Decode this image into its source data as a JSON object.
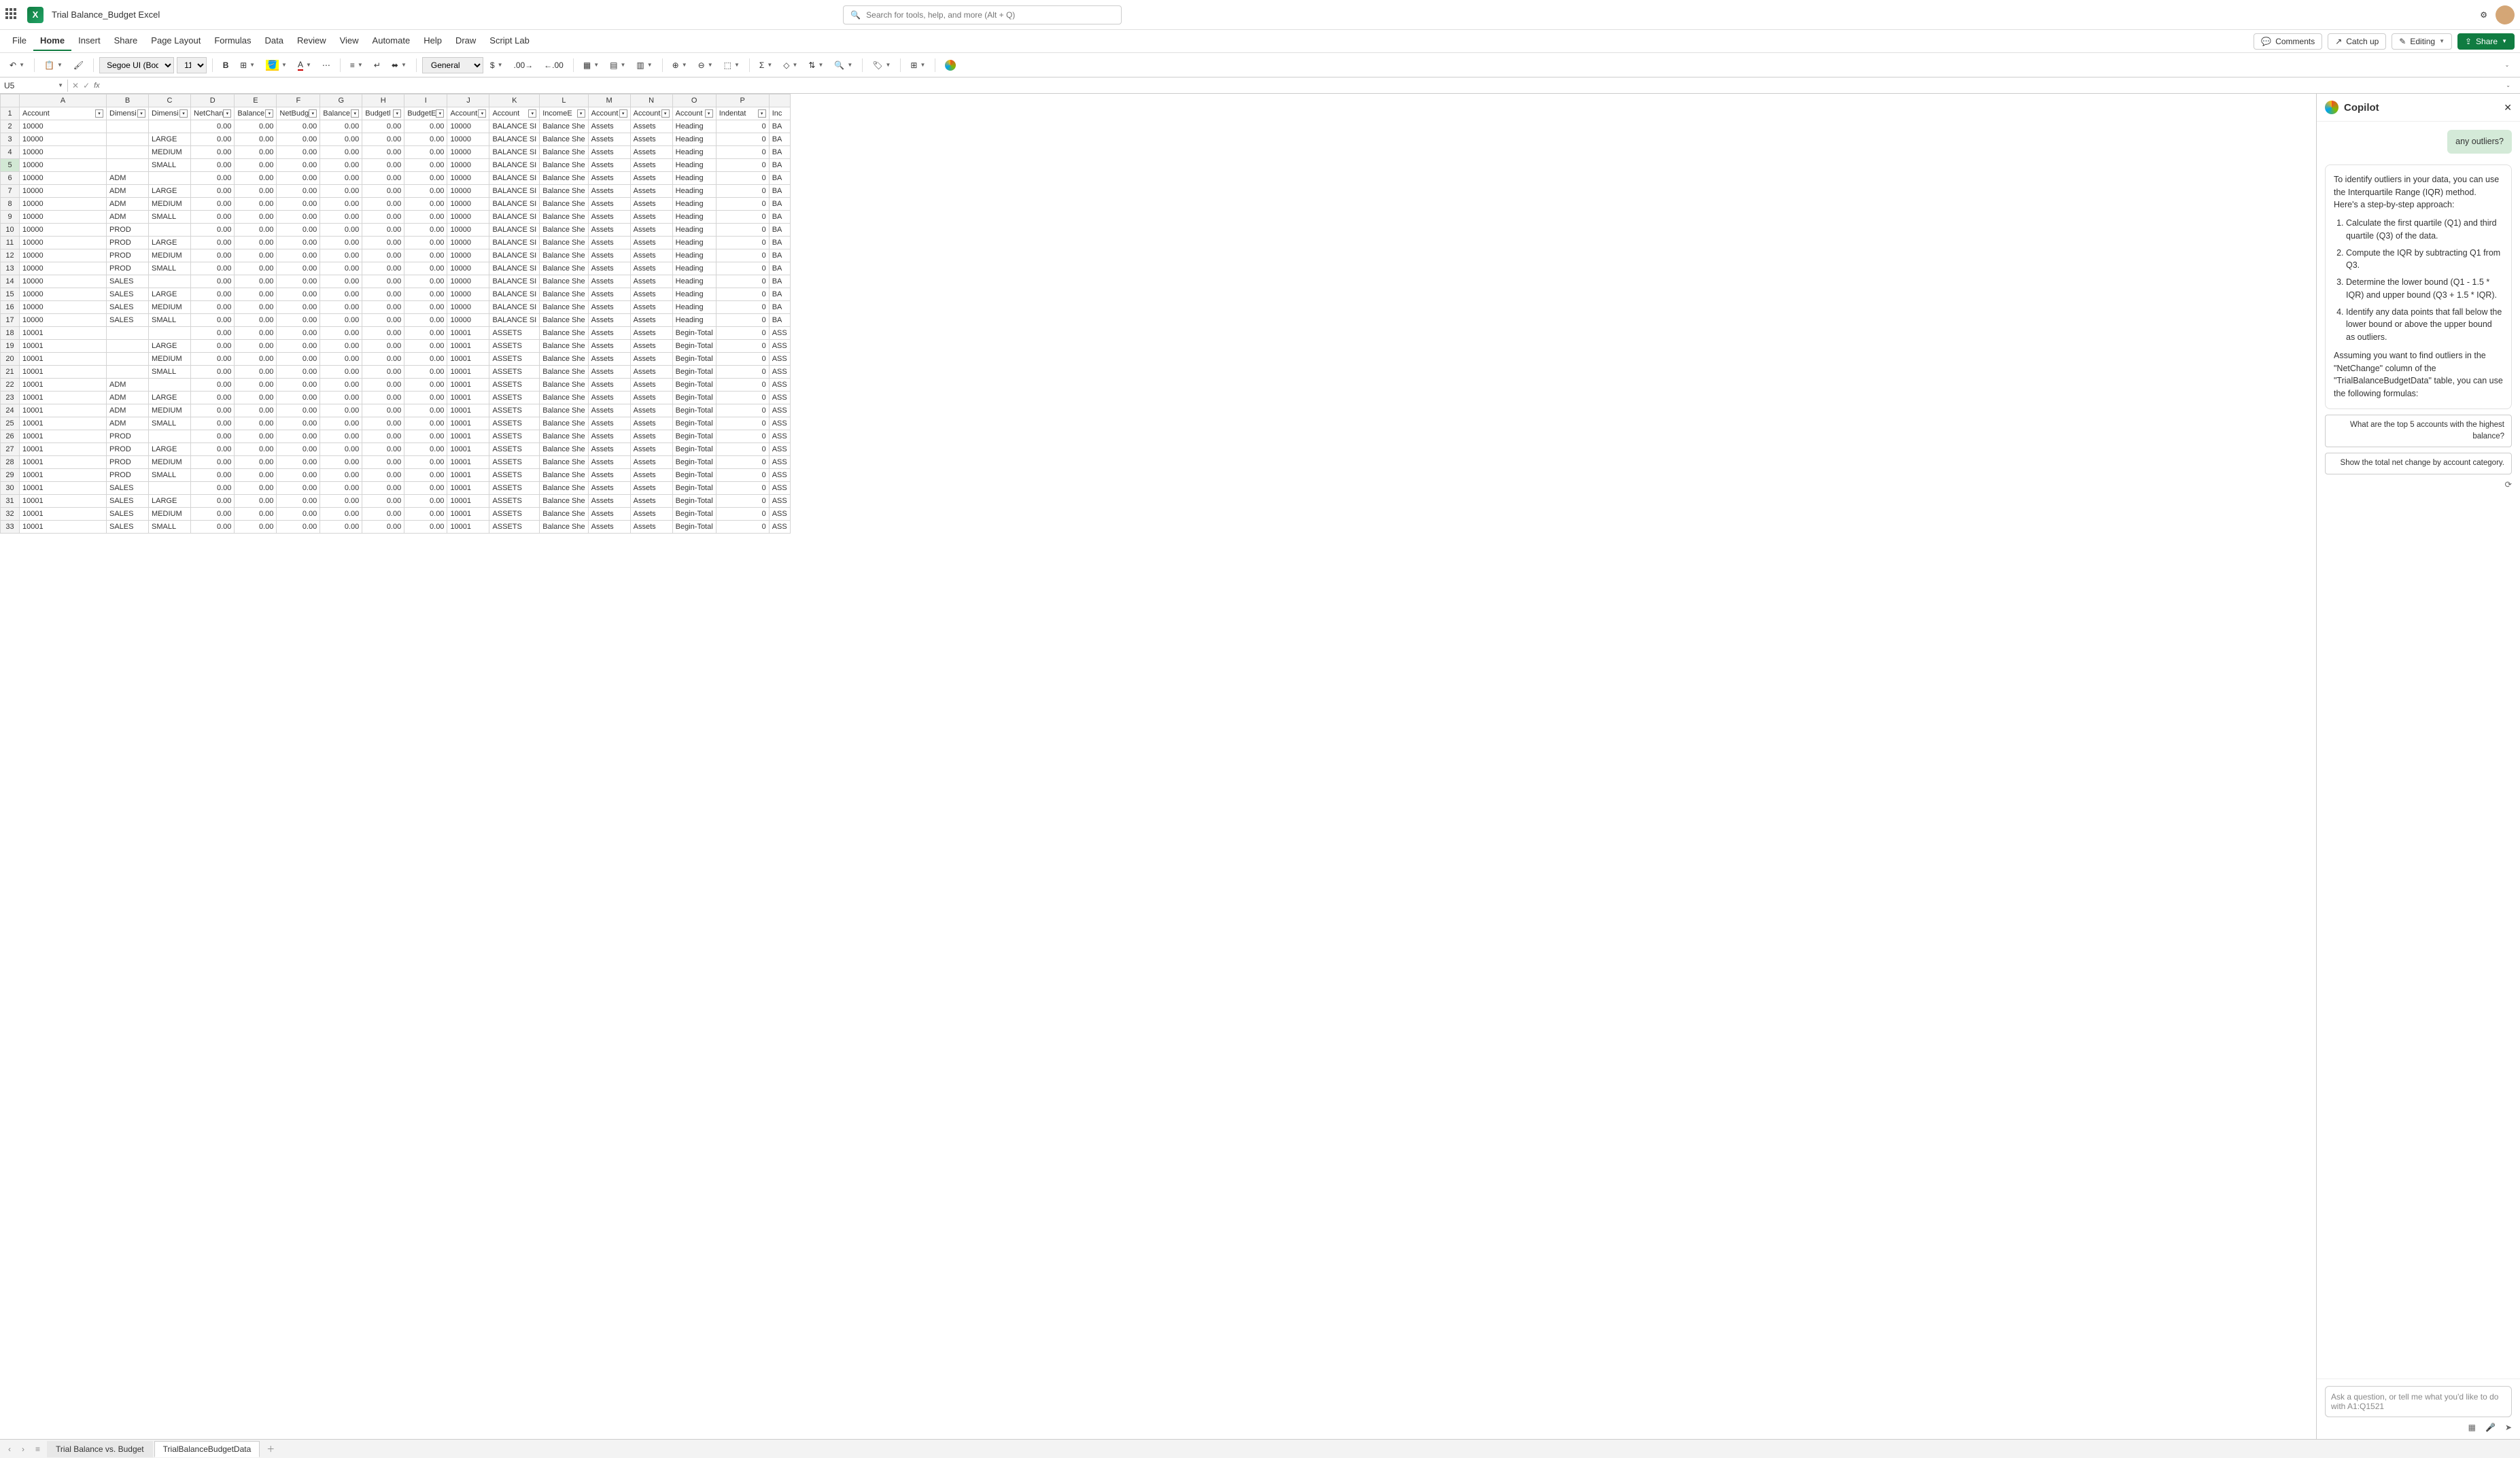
{
  "titlebar": {
    "doc_title": "Trial Balance_Budget Excel",
    "search_placeholder": "Search for tools, help, and more (Alt + Q)"
  },
  "menu": {
    "items": [
      "File",
      "Home",
      "Insert",
      "Share",
      "Page Layout",
      "Formulas",
      "Data",
      "Review",
      "View",
      "Automate",
      "Help",
      "Draw",
      "Script Lab"
    ],
    "active": "Home",
    "right": {
      "comments": "Comments",
      "catchup": "Catch up",
      "editing": "Editing",
      "share": "Share"
    }
  },
  "toolbar": {
    "font_name": "Segoe UI (Body)",
    "font_size": "11",
    "number_format": "General"
  },
  "formula": {
    "name_box": "U5"
  },
  "columns_letters": [
    "A",
    "B",
    "C",
    "D",
    "E",
    "F",
    "G",
    "H",
    "I",
    "J",
    "K",
    "L",
    "M",
    "N",
    "O",
    "P"
  ],
  "headers": [
    "Account",
    "Dimensi",
    "Dimensi",
    "NetChan",
    "Balance",
    "NetBudg",
    "Balance",
    "Budgetl",
    "BudgetE",
    "Account",
    "Account",
    "IncomeE",
    "Account",
    "Account",
    "Account",
    "Indentat"
  ],
  "partial_header_q": "Inc",
  "rows": [
    {
      "r": 2,
      "acct": "10000",
      "dim1": "",
      "dim2": "",
      "j": "10000",
      "k": "BALANCE SI",
      "l": "Balance She",
      "m": "Assets",
      "n": "Assets",
      "o": "Heading",
      "p": "0",
      "q": "BA"
    },
    {
      "r": 3,
      "acct": "10000",
      "dim1": "",
      "dim2": "LARGE",
      "j": "10000",
      "k": "BALANCE SI",
      "l": "Balance She",
      "m": "Assets",
      "n": "Assets",
      "o": "Heading",
      "p": "0",
      "q": "BA"
    },
    {
      "r": 4,
      "acct": "10000",
      "dim1": "",
      "dim2": "MEDIUM",
      "j": "10000",
      "k": "BALANCE SI",
      "l": "Balance She",
      "m": "Assets",
      "n": "Assets",
      "o": "Heading",
      "p": "0",
      "q": "BA"
    },
    {
      "r": 5,
      "acct": "10000",
      "dim1": "",
      "dim2": "SMALL",
      "j": "10000",
      "k": "BALANCE SI",
      "l": "Balance She",
      "m": "Assets",
      "n": "Assets",
      "o": "Heading",
      "p": "0",
      "q": "BA"
    },
    {
      "r": 6,
      "acct": "10000",
      "dim1": "ADM",
      "dim2": "",
      "j": "10000",
      "k": "BALANCE SI",
      "l": "Balance She",
      "m": "Assets",
      "n": "Assets",
      "o": "Heading",
      "p": "0",
      "q": "BA"
    },
    {
      "r": 7,
      "acct": "10000",
      "dim1": "ADM",
      "dim2": "LARGE",
      "j": "10000",
      "k": "BALANCE SI",
      "l": "Balance She",
      "m": "Assets",
      "n": "Assets",
      "o": "Heading",
      "p": "0",
      "q": "BA"
    },
    {
      "r": 8,
      "acct": "10000",
      "dim1": "ADM",
      "dim2": "MEDIUM",
      "j": "10000",
      "k": "BALANCE SI",
      "l": "Balance She",
      "m": "Assets",
      "n": "Assets",
      "o": "Heading",
      "p": "0",
      "q": "BA"
    },
    {
      "r": 9,
      "acct": "10000",
      "dim1": "ADM",
      "dim2": "SMALL",
      "j": "10000",
      "k": "BALANCE SI",
      "l": "Balance She",
      "m": "Assets",
      "n": "Assets",
      "o": "Heading",
      "p": "0",
      "q": "BA"
    },
    {
      "r": 10,
      "acct": "10000",
      "dim1": "PROD",
      "dim2": "",
      "j": "10000",
      "k": "BALANCE SI",
      "l": "Balance She",
      "m": "Assets",
      "n": "Assets",
      "o": "Heading",
      "p": "0",
      "q": "BA"
    },
    {
      "r": 11,
      "acct": "10000",
      "dim1": "PROD",
      "dim2": "LARGE",
      "j": "10000",
      "k": "BALANCE SI",
      "l": "Balance She",
      "m": "Assets",
      "n": "Assets",
      "o": "Heading",
      "p": "0",
      "q": "BA"
    },
    {
      "r": 12,
      "acct": "10000",
      "dim1": "PROD",
      "dim2": "MEDIUM",
      "j": "10000",
      "k": "BALANCE SI",
      "l": "Balance She",
      "m": "Assets",
      "n": "Assets",
      "o": "Heading",
      "p": "0",
      "q": "BA"
    },
    {
      "r": 13,
      "acct": "10000",
      "dim1": "PROD",
      "dim2": "SMALL",
      "j": "10000",
      "k": "BALANCE SI",
      "l": "Balance She",
      "m": "Assets",
      "n": "Assets",
      "o": "Heading",
      "p": "0",
      "q": "BA"
    },
    {
      "r": 14,
      "acct": "10000",
      "dim1": "SALES",
      "dim2": "",
      "j": "10000",
      "k": "BALANCE SI",
      "l": "Balance She",
      "m": "Assets",
      "n": "Assets",
      "o": "Heading",
      "p": "0",
      "q": "BA"
    },
    {
      "r": 15,
      "acct": "10000",
      "dim1": "SALES",
      "dim2": "LARGE",
      "j": "10000",
      "k": "BALANCE SI",
      "l": "Balance She",
      "m": "Assets",
      "n": "Assets",
      "o": "Heading",
      "p": "0",
      "q": "BA"
    },
    {
      "r": 16,
      "acct": "10000",
      "dim1": "SALES",
      "dim2": "MEDIUM",
      "j": "10000",
      "k": "BALANCE SI",
      "l": "Balance She",
      "m": "Assets",
      "n": "Assets",
      "o": "Heading",
      "p": "0",
      "q": "BA"
    },
    {
      "r": 17,
      "acct": "10000",
      "dim1": "SALES",
      "dim2": "SMALL",
      "j": "10000",
      "k": "BALANCE SI",
      "l": "Balance She",
      "m": "Assets",
      "n": "Assets",
      "o": "Heading",
      "p": "0",
      "q": "BA"
    },
    {
      "r": 18,
      "acct": "10001",
      "dim1": "",
      "dim2": "",
      "j": "10001",
      "k": "ASSETS",
      "l": "Balance She",
      "m": "Assets",
      "n": "Assets",
      "o": "Begin-Total",
      "p": "0",
      "q": "ASS"
    },
    {
      "r": 19,
      "acct": "10001",
      "dim1": "",
      "dim2": "LARGE",
      "j": "10001",
      "k": "ASSETS",
      "l": "Balance She",
      "m": "Assets",
      "n": "Assets",
      "o": "Begin-Total",
      "p": "0",
      "q": "ASS"
    },
    {
      "r": 20,
      "acct": "10001",
      "dim1": "",
      "dim2": "MEDIUM",
      "j": "10001",
      "k": "ASSETS",
      "l": "Balance She",
      "m": "Assets",
      "n": "Assets",
      "o": "Begin-Total",
      "p": "0",
      "q": "ASS"
    },
    {
      "r": 21,
      "acct": "10001",
      "dim1": "",
      "dim2": "SMALL",
      "j": "10001",
      "k": "ASSETS",
      "l": "Balance She",
      "m": "Assets",
      "n": "Assets",
      "o": "Begin-Total",
      "p": "0",
      "q": "ASS"
    },
    {
      "r": 22,
      "acct": "10001",
      "dim1": "ADM",
      "dim2": "",
      "j": "10001",
      "k": "ASSETS",
      "l": "Balance She",
      "m": "Assets",
      "n": "Assets",
      "o": "Begin-Total",
      "p": "0",
      "q": "ASS"
    },
    {
      "r": 23,
      "acct": "10001",
      "dim1": "ADM",
      "dim2": "LARGE",
      "j": "10001",
      "k": "ASSETS",
      "l": "Balance She",
      "m": "Assets",
      "n": "Assets",
      "o": "Begin-Total",
      "p": "0",
      "q": "ASS"
    },
    {
      "r": 24,
      "acct": "10001",
      "dim1": "ADM",
      "dim2": "MEDIUM",
      "j": "10001",
      "k": "ASSETS",
      "l": "Balance She",
      "m": "Assets",
      "n": "Assets",
      "o": "Begin-Total",
      "p": "0",
      "q": "ASS"
    },
    {
      "r": 25,
      "acct": "10001",
      "dim1": "ADM",
      "dim2": "SMALL",
      "j": "10001",
      "k": "ASSETS",
      "l": "Balance She",
      "m": "Assets",
      "n": "Assets",
      "o": "Begin-Total",
      "p": "0",
      "q": "ASS"
    },
    {
      "r": 26,
      "acct": "10001",
      "dim1": "PROD",
      "dim2": "",
      "j": "10001",
      "k": "ASSETS",
      "l": "Balance She",
      "m": "Assets",
      "n": "Assets",
      "o": "Begin-Total",
      "p": "0",
      "q": "ASS"
    },
    {
      "r": 27,
      "acct": "10001",
      "dim1": "PROD",
      "dim2": "LARGE",
      "j": "10001",
      "k": "ASSETS",
      "l": "Balance She",
      "m": "Assets",
      "n": "Assets",
      "o": "Begin-Total",
      "p": "0",
      "q": "ASS"
    },
    {
      "r": 28,
      "acct": "10001",
      "dim1": "PROD",
      "dim2": "MEDIUM",
      "j": "10001",
      "k": "ASSETS",
      "l": "Balance She",
      "m": "Assets",
      "n": "Assets",
      "o": "Begin-Total",
      "p": "0",
      "q": "ASS"
    },
    {
      "r": 29,
      "acct": "10001",
      "dim1": "PROD",
      "dim2": "SMALL",
      "j": "10001",
      "k": "ASSETS",
      "l": "Balance She",
      "m": "Assets",
      "n": "Assets",
      "o": "Begin-Total",
      "p": "0",
      "q": "ASS"
    },
    {
      "r": 30,
      "acct": "10001",
      "dim1": "SALES",
      "dim2": "",
      "j": "10001",
      "k": "ASSETS",
      "l": "Balance She",
      "m": "Assets",
      "n": "Assets",
      "o": "Begin-Total",
      "p": "0",
      "q": "ASS"
    },
    {
      "r": 31,
      "acct": "10001",
      "dim1": "SALES",
      "dim2": "LARGE",
      "j": "10001",
      "k": "ASSETS",
      "l": "Balance She",
      "m": "Assets",
      "n": "Assets",
      "o": "Begin-Total",
      "p": "0",
      "q": "ASS"
    },
    {
      "r": 32,
      "acct": "10001",
      "dim1": "SALES",
      "dim2": "MEDIUM",
      "j": "10001",
      "k": "ASSETS",
      "l": "Balance She",
      "m": "Assets",
      "n": "Assets",
      "o": "Begin-Total",
      "p": "0",
      "q": "ASS"
    },
    {
      "r": 33,
      "acct": "10001",
      "dim1": "SALES",
      "dim2": "SMALL",
      "j": "10001",
      "k": "ASSETS",
      "l": "Balance She",
      "m": "Assets",
      "n": "Assets",
      "o": "Begin-Total",
      "p": "0",
      "q": "ASS"
    }
  ],
  "zero": "0.00",
  "sheets": {
    "tabs": [
      "Trial Balance vs. Budget",
      "TrialBalanceBudgetData"
    ],
    "active": "TrialBalanceBudgetData"
  },
  "copilot": {
    "title": "Copilot",
    "user_msg": "any outliers?",
    "intro": "To identify outliers in your data, you can use the Interquartile Range (IQR) method. Here's a step-by-step approach:",
    "steps": [
      "Calculate the first quartile (Q1) and third quartile (Q3) of the data.",
      "Compute the IQR by subtracting Q1 from Q3.",
      "Determine the lower bound (Q1 - 1.5 * IQR) and upper bound (Q3 + 1.5 * IQR).",
      "Identify any data points that fall below the lower bound or above the upper bound as outliers."
    ],
    "para2": "Assuming you want to find outliers in the \"NetChange\" column of the \"TrialBalanceBudgetData\" table, you can use the following formulas:",
    "suggest1": "What are the top 5 accounts with the highest balance?",
    "suggest2": "Show the total net change by account category.",
    "input_placeholder": "Ask a question, or tell me what you'd like to do with A1:Q1521"
  }
}
